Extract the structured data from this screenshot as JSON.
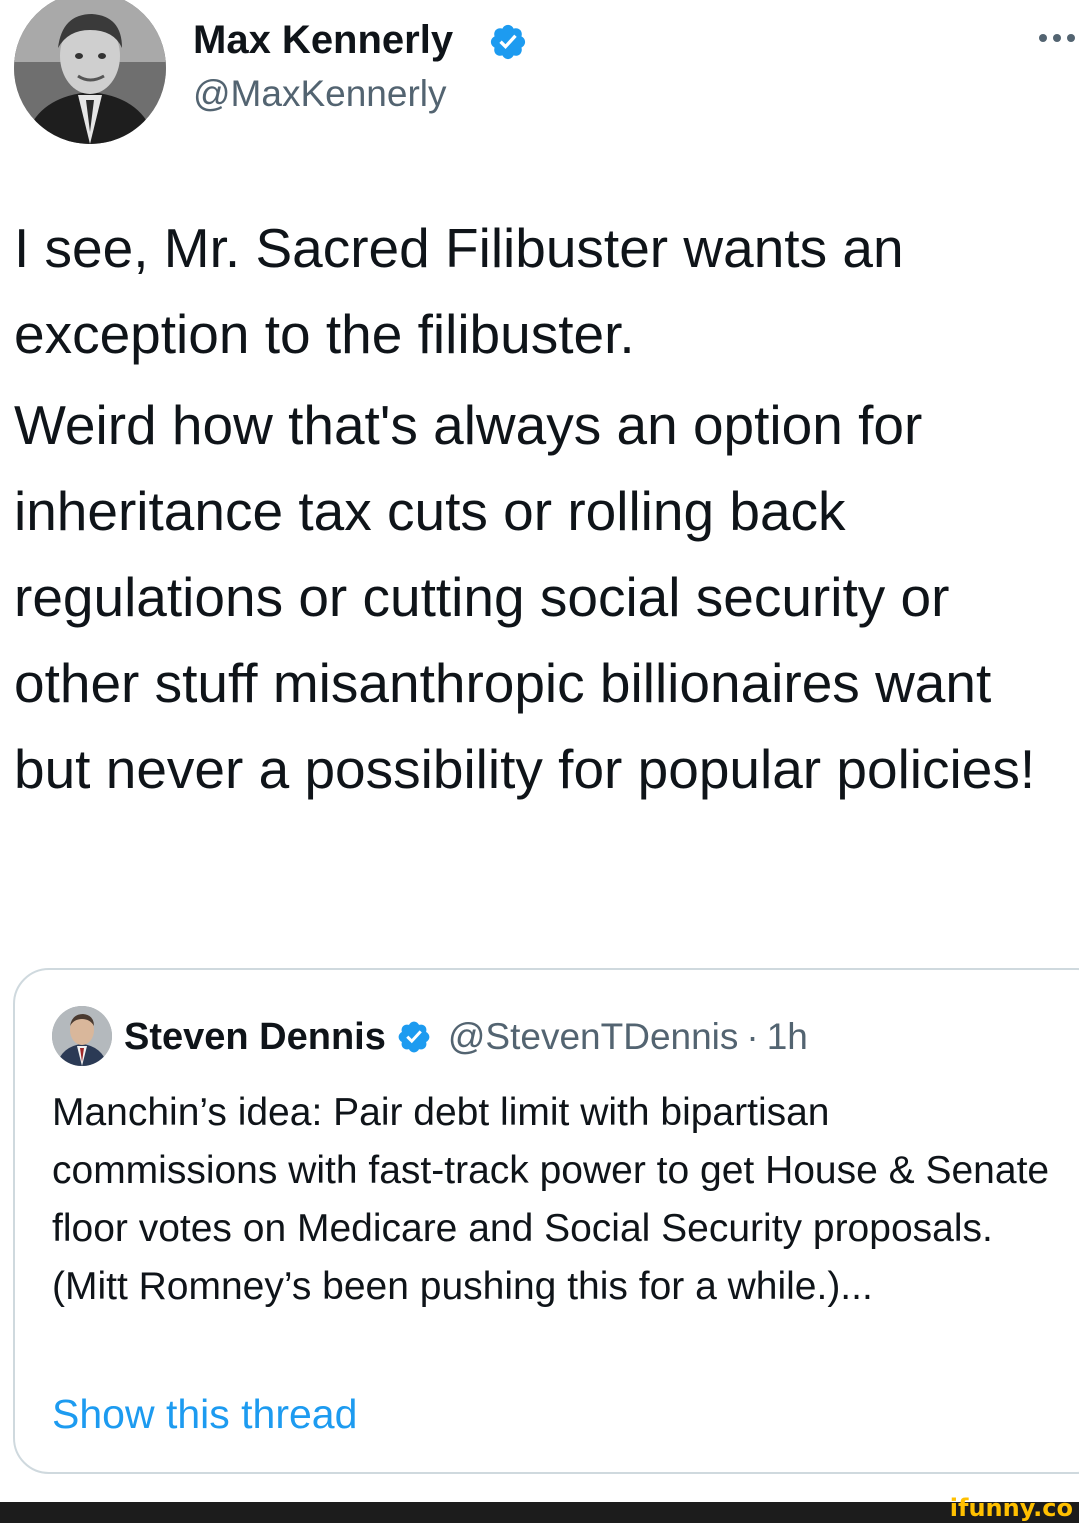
{
  "tweet": {
    "author": {
      "name": "Max Kennerly",
      "handle": "@MaxKennerly",
      "verified": true
    },
    "text": [
      "I see, Mr. Sacred Filibuster wants an exception to the filibuster.",
      "Weird how that's always an option for inheritance tax cuts or rolling back regulations or cutting social security or other stuff misanthropic billionaires want but never a possibility for popular policies!"
    ],
    "more_icon": "more-horizontal-icon"
  },
  "quote": {
    "author": {
      "name": "Steven Dennis",
      "handle": "@StevenTDennis",
      "verified": true
    },
    "separator": "·",
    "time": "1h",
    "text": "Manchin’s idea: Pair debt limit with bipartisan commissions with fast-track power to get House & Senate floor votes on Medicare and Social Security proposals. (Mitt Romney’s been pushing this for a while.)...",
    "show_thread_label": "Show this thread"
  },
  "watermark": {
    "text": "ifunny.co"
  },
  "colors": {
    "verified": "#1d9bf0",
    "link": "#1d9bf0",
    "secondary_text": "#536471",
    "border": "#cfd9de",
    "watermark": "#ffc000"
  }
}
